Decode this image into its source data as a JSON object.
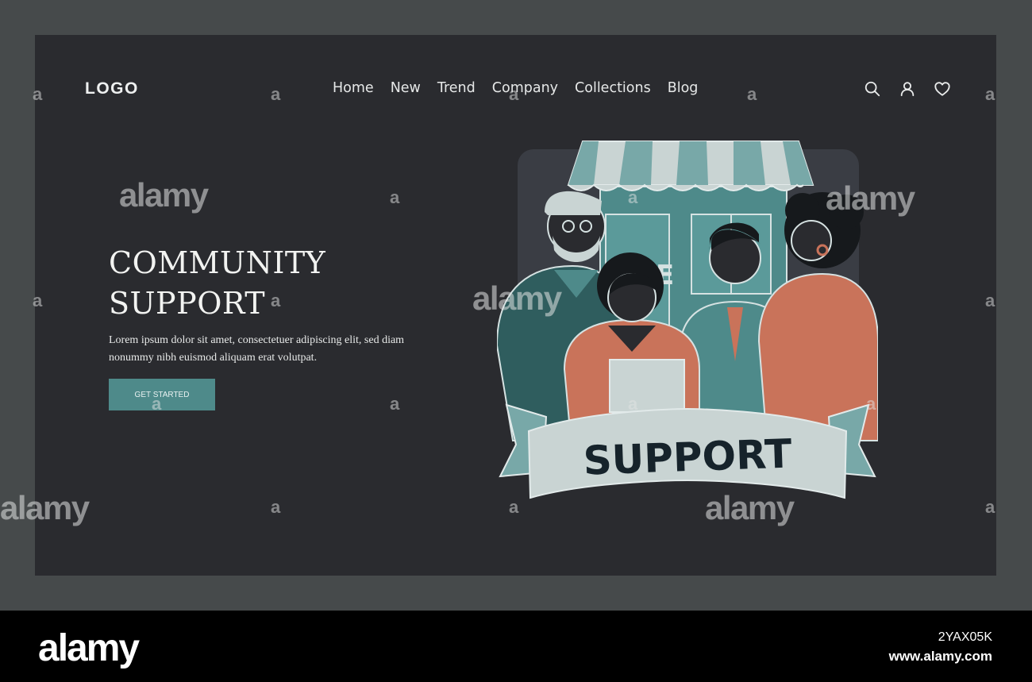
{
  "header": {
    "logo": "LOGO",
    "nav": [
      "Home",
      "New",
      "Trend",
      "Company",
      "Collections",
      "Blog"
    ],
    "icons": [
      "search-icon",
      "user-icon",
      "heart-icon"
    ]
  },
  "hero": {
    "title_line1": "COMMUNITY",
    "title_line2": "SUPPORT",
    "description": "Lorem ipsum dolor sit amet, consectetuer adipiscing elit, sed diam nonummy nibh euismod aliquam erat volutpat.",
    "cta_label": "GET STARTED"
  },
  "illustration": {
    "banner_text": "SUPPORT",
    "sign_letter": "E"
  },
  "watermark": {
    "text": "alamy",
    "letter": "a"
  },
  "footer": {
    "logo": "alamy",
    "image_id": "2YAX05K",
    "url": "www.alamy.com"
  },
  "colors": {
    "page_bg": "#2a2b2f",
    "outer_bg": "#464a4b",
    "accent_teal": "#4e8a8a",
    "coral": "#c9735a",
    "text_light": "#f2f3f1"
  }
}
